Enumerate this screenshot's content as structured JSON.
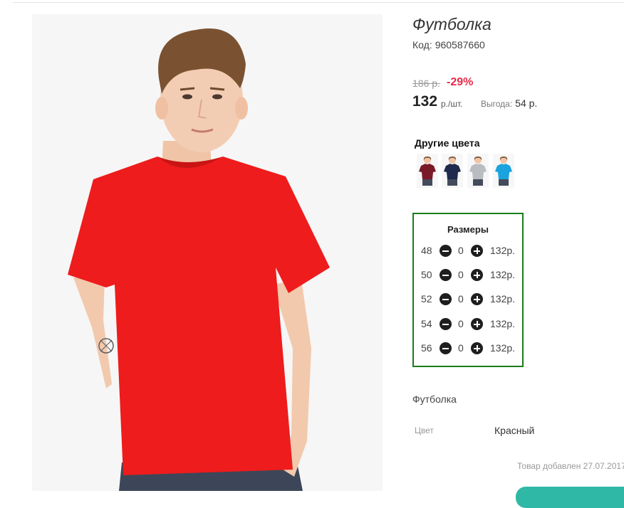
{
  "product": {
    "title": "Футболка",
    "code_label": "Код:",
    "code": "960587660",
    "old_price": "186 р.",
    "discount": "-29%",
    "price": "132",
    "unit": "р./шт.",
    "benefit_label": "Выгода:",
    "benefit_value": "54 р."
  },
  "colors": {
    "title": "Другие цвета",
    "swatches": [
      {
        "name": "бордовый",
        "color": "#7a1a28"
      },
      {
        "name": "тёмно-синий",
        "color": "#1f2a4d"
      },
      {
        "name": "серый",
        "color": "#b9bcc0"
      },
      {
        "name": "голубой",
        "color": "#1aa3dd"
      }
    ]
  },
  "sizes": {
    "title": "Размеры",
    "rows": [
      {
        "size": "48",
        "qty": "0",
        "price": "132р."
      },
      {
        "size": "50",
        "qty": "0",
        "price": "132р."
      },
      {
        "size": "52",
        "qty": "0",
        "price": "132р."
      },
      {
        "size": "54",
        "qty": "0",
        "price": "132р."
      },
      {
        "size": "56",
        "qty": "0",
        "price": "132р."
      }
    ]
  },
  "details": {
    "description": "Футболка",
    "color_label": "Цвет",
    "color_value": "Красный",
    "added": "Товар добавлен 27.07.2017"
  },
  "theme": {
    "shirt_color": "#ee1c1c",
    "discount_color": "#e8294a",
    "sizes_border": "#1a7e1a",
    "chat_color": "#2fb8a6"
  }
}
